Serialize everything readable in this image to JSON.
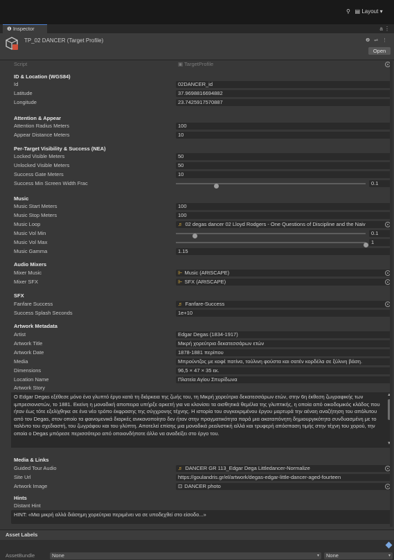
{
  "toolbar": {
    "layout_label": "Layout",
    "icons": [
      "cloud-icon",
      "history-icon",
      "search-icon",
      "layout-icon"
    ]
  },
  "tab": {
    "label": "Inspector"
  },
  "header": {
    "title": "TP_02 DANCER (Target Profile)",
    "open_label": "Open"
  },
  "script": {
    "label": "Script",
    "value": "TargetProfile"
  },
  "id_location": {
    "title": "ID & Location (WGS84)",
    "id_label": "Id",
    "id_value": "02DANCER_id",
    "lat_label": "Latitude",
    "lat_value": "37.9698816694882",
    "lon_label": "Longitude",
    "lon_value": "23.7425917570887"
  },
  "attention": {
    "title": "Attention & Appear",
    "radius_label": "Attention Radius Meters",
    "radius_value": "100",
    "appear_label": "Appear Distance Meters",
    "appear_value": "10"
  },
  "visibility": {
    "title": "Per-Target Visibility & Success (NEA)",
    "locked_label": "Locked Visible Meters",
    "locked_value": "50",
    "unlocked_label": "Unlocked Visible Meters",
    "unlocked_value": "50",
    "gate_label": "Success Gate Meters",
    "gate_value": "10",
    "screen_label": "Success Min Screen Width Frac",
    "screen_value": "0.1",
    "screen_fraction": 0.21
  },
  "music": {
    "title": "Music",
    "start_label": "Music Start Meters",
    "start_value": "100",
    "stop_label": "Music Stop Meters",
    "stop_value": "100",
    "loop_label": "Music Loop",
    "loop_value": "02 degas dancer 02 Lloyd Rodgers - One Questions of Discipline and the Naiv",
    "volmin_label": "Music Vol Min",
    "volmin_value": "0.1",
    "volmin_fraction": 0.1,
    "volmax_label": "Music Vol Max",
    "volmax_value": "1",
    "volmax_fraction": 1.0,
    "gamma_label": "Music Gamma",
    "gamma_value": "1.15"
  },
  "mixers": {
    "title": "Audio Mixers",
    "music_label": "Mixer Music",
    "music_value": "Music (ARtSCAPE)",
    "sfx_label": "Mixer SFX",
    "sfx_value": "SFX (ARtSCAPE)"
  },
  "sfx": {
    "title": "SFX",
    "fanfare_label": "Fanfare Success",
    "fanfare_value": "Fanfare-Success",
    "splash_label": "Success Splash Seconds",
    "splash_value": "1e+10"
  },
  "artwork": {
    "title": "Artwork Metadata",
    "artist_label": "Artist",
    "artist_value": "Edgar Degas (1834-1917)",
    "work_title_label": "Artwork Title",
    "work_title_value": "Μικρή χορεύτρια δεκατεσσάρων ετών",
    "date_label": "Artwork Date",
    "date_value": "1878-1881 περίπου",
    "media_label": "Media",
    "media_value": "Μπρούντζος με κοφέ πατίνα, τούλινη φούστα και σατέν κορδέλα σε ξύλινη βάση.",
    "dims_label": "Dimensions",
    "dims_value": "96,5 × 47 × 35 εκ.",
    "location_label": "Location Name",
    "location_value": "Πλατεία Αγίου Σπυρίδωνα",
    "story_label": "Artwork Story",
    "story_value": "Ο Edgar Degas εξέθεσε μόνο ένα γλυπτό έργο κατά τη διάρκεια της ζωής του, τη Μικρή χορεύτρια δεκατεσσάρων ετών, στην 6η έκθεση ζωγραφικής των ιμπρεσιονιστών, το 1881. Εκείνη η μοναδική αποπειρα υπήρξε αρκετή για να κλονίσει τα αισθητικά θεμέλια της γλυπτικής, η οποία από οικοδομικός κλάδος που ήταν έως τότε εξελίχθηκε σε ένα νέο τρόπο έκφρασης της σύγχρονης τέχνης. Η ιστορία του συγκεκριμένου έργου μαρτυρά την αέναη αναζήτηση του απόλυτου από τον Degas, στον οποίο τα φαινομενικά διαρκές ανικανοποίητο δεν ήταν στην πραγματικότητα παρά μια ακαταπόνητη δημιουργικότητα συνδυασμένη με το ταλέντο του σχεδιαστή, του ζωγράφου και του γλύπτη. Αποτελεί επίσης μια μοναδικά ρεαλιστική αλλά και τρυφερή απόσπαση τιμής στην τέχνη του χορού, την οποία ο Degas μπόρεσε περισσότερο από οποιονδήποτε άλλο να αναδείξει στο έργο του."
  },
  "media": {
    "title": "Media & Links",
    "audio_label": "Guided Tour Audio",
    "audio_value": "DANCER GR 113_Edgar Dega Littledancer-Normalize",
    "url_label": "Site Url",
    "url_value": "https://goulandris.gr/el/artwork/degas-edgar-little-dancer-aged-fourteen",
    "image_label": "Artwork Image",
    "image_value": "DANCER photo"
  },
  "hints": {
    "title": "Hints",
    "distant_label": "Distant Hint",
    "distant_value": "HINT: «Μια μικρή αλλά διάσημη χορεύτρια περιμένει να σε υποδεχθεί στο είσοδο...»"
  },
  "asset_labels": {
    "title": "Asset Labels"
  },
  "bundle": {
    "label": "AssetBundle",
    "value": "None",
    "variant": "None"
  }
}
